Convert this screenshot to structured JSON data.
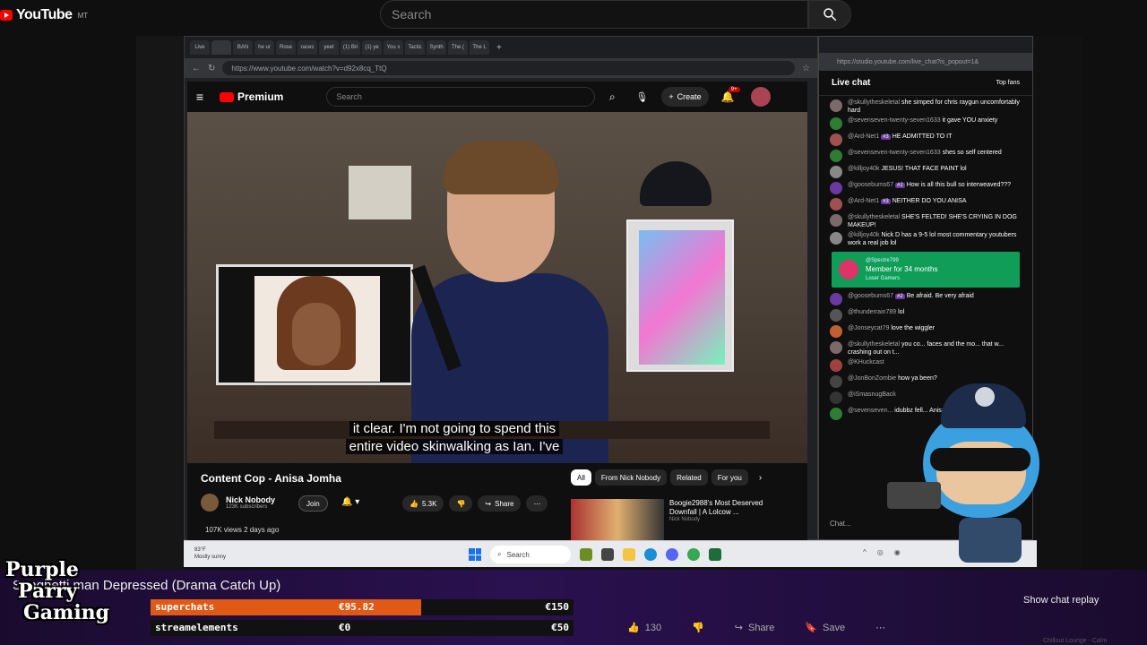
{
  "youtube": {
    "logo": "YouTube",
    "logo_sup": "MT",
    "search_placeholder": "Search"
  },
  "browser": {
    "tabs": [
      "Live",
      "",
      "BAN",
      "he ur",
      "Rose",
      "races",
      "yeet",
      "(1) Bri",
      "(1) ye",
      "You x",
      "Tactic",
      "Synth",
      "The (",
      "The L"
    ],
    "url": "https://www.youtube.com/watch?v=d92x8cq_TtQ"
  },
  "inner_youtube": {
    "logo": "Premium",
    "search_placeholder": "Search",
    "create_label": "Create",
    "notif_count": "9+"
  },
  "video": {
    "caption_line1": "it clear. I'm not going to spend this",
    "caption_line2": "entire video skinwalking as Ian. I've"
  },
  "below_video": {
    "title": "Content Cop - Anisa Jomha",
    "channel": "Nick Nobody",
    "subs": "123K subscribers",
    "join": "Join",
    "likes": "5.3K",
    "share": "Share",
    "views": "107K views  2 days ago",
    "chips": [
      "All",
      "From Nick Nobody",
      "Related",
      "For you"
    ],
    "rec_title": "Boogie2988's Most Deserved Downfall | A Lolcow ...",
    "rec_by": "Nick Nobody"
  },
  "taskbar": {
    "weather": "83°F",
    "weather_sub": "Mostly sunny",
    "search": "Search"
  },
  "chat": {
    "url": "https://studio.youtube.com/live_chat?is_popout=1&",
    "header": "Live chat",
    "filter": "Top fans",
    "messages": [
      {
        "user": "@skullytheskeletal",
        "text": "she simped for chris raygun uncomfortably hard",
        "color": "#7a6a6a"
      },
      {
        "user": "@sevenseven-twenty-seven1633",
        "text": "it gave YOU anxiety",
        "color": "#2e7d32"
      },
      {
        "user": "@Ard-Net1",
        "badge": "#3",
        "text": "HE ADMITTED TO IT",
        "color": "#a05050"
      },
      {
        "user": "@sevenseven-twenty-seven1633",
        "text": "shes so self centered",
        "color": "#2e7d32"
      },
      {
        "user": "@killjoy40k",
        "text": "JESUS! THAT FACE PAINT lol",
        "color": "#888"
      },
      {
        "user": "@goosebums67",
        "badge": "#2",
        "text": "How is all this bull so interweaved???",
        "color": "#6a3aa0"
      },
      {
        "user": "@Ard-Net1",
        "badge": "#3",
        "text": "NEITHER DO YOU ANISA",
        "color": "#a05050"
      },
      {
        "user": "@skullytheskeletal",
        "text": "SHE'S FELTED! SHE'S CRYING IN DOG MAKEUP!",
        "color": "#7a6a6a"
      },
      {
        "user": "@killjoy40k",
        "text": "Nick D has a 9-5 lol most commentary youtubers work a real job lol",
        "color": "#888"
      }
    ],
    "member": {
      "user": "@Spectre799",
      "text": "Member for 34 months",
      "sub": "Loser Gamers"
    },
    "messages2": [
      {
        "user": "@goosebums67",
        "badge": "#2",
        "text": "Be afraid. Be very afraid",
        "color": "#6a3aa0"
      },
      {
        "user": "@thunderrain789",
        "text": "lol",
        "color": "#555"
      },
      {
        "user": "@Jonseycat79",
        "text": "love the wiggler",
        "color": "#c06030"
      },
      {
        "user": "@skullytheskeletal",
        "text": "you co... faces and the mo... that w... crashing out on t...",
        "color": "#7a6a6a"
      },
      {
        "user": "@KHuckcast",
        "text": "",
        "color": "#a04040"
      },
      {
        "user": "@JonBonZombie",
        "text": "how ya been?",
        "color": "#444"
      },
      {
        "user": "@iSmasnugBack",
        "text": "",
        "color": "#333"
      },
      {
        "user": "@sevenseven...",
        "text": "idubbz fell... Anisa ent...",
        "color": "#2e7d32"
      }
    ],
    "input_placeholder": "Chat..."
  },
  "overlay": {
    "stream_title": "Spaghetti man Depressed (Drama Catch Up)",
    "logo_lines": [
      "Purple",
      "Parry",
      "Gaming"
    ],
    "goals": [
      {
        "label": "superchats",
        "current": "€95.82",
        "max": "€150",
        "progress": 0.64
      },
      {
        "label": "streamelements",
        "current": "€0",
        "max": "€50",
        "progress": 0
      }
    ],
    "show_chat_replay": "Show chat replay",
    "likes": "130",
    "share": "Share",
    "save": "Save",
    "faint": "Chillout Lounge - Calm"
  }
}
